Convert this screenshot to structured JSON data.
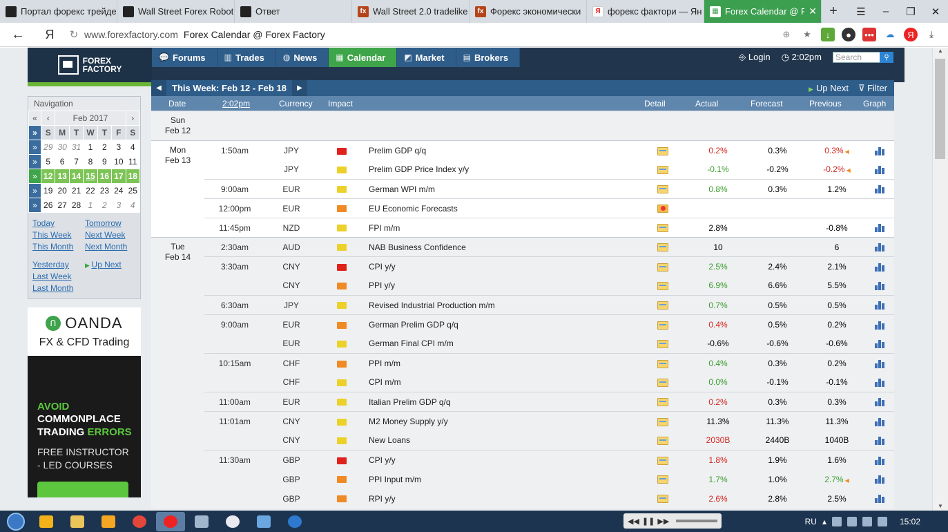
{
  "browser": {
    "tabs": [
      {
        "title": "Портал форекс трейде",
        "favicon": "dark",
        "active": false
      },
      {
        "title": "Wall Street Forex Robot",
        "favicon": "dark",
        "active": false
      },
      {
        "title": "Ответ",
        "favicon": "dark",
        "active": false
      },
      {
        "title": "Wall Street 2.0 tradelike",
        "favicon": "ff",
        "active": false
      },
      {
        "title": "Форекс экономически",
        "favicon": "ff",
        "active": false
      },
      {
        "title": "форекс фактори — Ян",
        "favicon": "yandex",
        "active": false
      },
      {
        "title": "Forex Calendar @ Fo",
        "favicon": "ff-green",
        "active": true
      }
    ],
    "new_tab": "+",
    "yandex_logo": "Я",
    "url_host": "www.forexfactory.com",
    "url_title": "Forex Calendar @ Forex Factory"
  },
  "site": {
    "logo_line1": "FOREX",
    "logo_line2": "FACTORY",
    "nav": [
      {
        "label": "Forums",
        "icon": "forums-icon",
        "active": false
      },
      {
        "label": "Trades",
        "icon": "trades-icon",
        "active": false
      },
      {
        "label": "News",
        "icon": "news-icon",
        "active": false
      },
      {
        "label": "Calendar",
        "icon": "calendar-icon",
        "active": true
      },
      {
        "label": "Market",
        "icon": "market-icon",
        "active": false
      },
      {
        "label": "Brokers",
        "icon": "brokers-icon",
        "active": false
      }
    ],
    "login": "Login",
    "time": "2:02pm",
    "search_placeholder": "Search"
  },
  "sidebar": {
    "title": "Navigation",
    "month": "Feb 2017",
    "weekdays": [
      "S",
      "M",
      "T",
      "W",
      "T",
      "F",
      "S"
    ],
    "weeks": [
      [
        "29",
        "30",
        "31",
        "1",
        "2",
        "3",
        "4"
      ],
      [
        "5",
        "6",
        "7",
        "8",
        "9",
        "10",
        "11"
      ],
      [
        "12",
        "13",
        "14",
        "15",
        "16",
        "17",
        "18"
      ],
      [
        "19",
        "20",
        "21",
        "22",
        "23",
        "24",
        "25"
      ],
      [
        "26",
        "27",
        "28",
        "1",
        "2",
        "3",
        "4"
      ]
    ],
    "links": {
      "today": "Today",
      "tomorrow": "Tomorrow",
      "this_week": "This Week",
      "next_week": "Next Week",
      "this_month": "This Month",
      "next_month": "Next Month",
      "yesterday": "Yesterday",
      "up_next": "Up Next",
      "last_week": "Last Week",
      "last_month": "Last Month"
    },
    "ad": {
      "brand": "OANDA",
      "sub": "FX & CFD Trading",
      "line1": "AVOID",
      "line2": "COMMONPLACE",
      "line3a": "TRADING ",
      "line3b": "ERRORS",
      "line4a": "FREE INSTRUCTOR",
      "line4b": "- LED COURSES"
    }
  },
  "calendar": {
    "week_label": "This Week: Feb 12 - Feb 18",
    "up_next": "Up Next",
    "filter": "Filter",
    "columns": {
      "date": "Date",
      "time": "2:02pm",
      "currency": "Currency",
      "impact": "Impact",
      "detail": "Detail",
      "actual": "Actual",
      "forecast": "Forecast",
      "previous": "Previous",
      "graph": "Graph"
    },
    "days": [
      {
        "weekday": "Sun",
        "date": "Feb 12",
        "events": []
      },
      {
        "weekday": "Mon",
        "date": "Feb 13",
        "events": [
          {
            "time": "1:50am",
            "currency": "JPY",
            "impact": "high",
            "event": "Prelim GDP q/q",
            "detail": "folder",
            "actual": "0.2%",
            "actual_color": "neg",
            "forecast": "0.3%",
            "previous": "0.3%",
            "previous_color": "neg",
            "revised": true,
            "graph": true
          },
          {
            "time": "",
            "currency": "JPY",
            "impact": "low",
            "event": "Prelim GDP Price Index y/y",
            "detail": "folder",
            "actual": "-0.1%",
            "actual_color": "pos",
            "forecast": "-0.2%",
            "previous": "-0.2%",
            "previous_color": "neg",
            "revised": true,
            "graph": true
          },
          {
            "time": "9:00am",
            "currency": "EUR",
            "impact": "low",
            "event": "German WPI m/m",
            "detail": "folder",
            "actual": "0.8%",
            "actual_color": "pos",
            "forecast": "0.3%",
            "previous": "1.2%",
            "previous_color": "",
            "revised": false,
            "graph": true
          },
          {
            "time": "12:00pm",
            "currency": "EUR",
            "impact": "medium",
            "event": "EU Economic Forecasts",
            "detail": "star",
            "actual": "",
            "actual_color": "",
            "forecast": "",
            "previous": "",
            "previous_color": "",
            "revised": false,
            "graph": false
          },
          {
            "time": "11:45pm",
            "currency": "NZD",
            "impact": "low",
            "event": "FPI m/m",
            "detail": "folder",
            "actual": "2.8%",
            "actual_color": "",
            "forecast": "",
            "previous": "-0.8%",
            "previous_color": "",
            "revised": false,
            "graph": true
          }
        ]
      },
      {
        "weekday": "Tue",
        "date": "Feb 14",
        "events": [
          {
            "time": "2:30am",
            "currency": "AUD",
            "impact": "low",
            "event": "NAB Business Confidence",
            "detail": "folder",
            "actual": "10",
            "actual_color": "",
            "forecast": "",
            "previous": "6",
            "previous_color": "",
            "revised": false,
            "graph": true
          },
          {
            "time": "3:30am",
            "currency": "CNY",
            "impact": "high",
            "event": "CPI y/y",
            "detail": "folder",
            "actual": "2.5%",
            "actual_color": "pos",
            "forecast": "2.4%",
            "previous": "2.1%",
            "previous_color": "",
            "revised": false,
            "graph": true
          },
          {
            "time": "",
            "currency": "CNY",
            "impact": "medium",
            "event": "PPI y/y",
            "detail": "folder",
            "actual": "6.9%",
            "actual_color": "pos",
            "forecast": "6.6%",
            "previous": "5.5%",
            "previous_color": "",
            "revised": false,
            "graph": true
          },
          {
            "time": "6:30am",
            "currency": "JPY",
            "impact": "low",
            "event": "Revised Industrial Production m/m",
            "detail": "folder",
            "actual": "0.7%",
            "actual_color": "pos",
            "forecast": "0.5%",
            "previous": "0.5%",
            "previous_color": "",
            "revised": false,
            "graph": true
          },
          {
            "time": "9:00am",
            "currency": "EUR",
            "impact": "medium",
            "event": "German Prelim GDP q/q",
            "detail": "folder",
            "actual": "0.4%",
            "actual_color": "neg",
            "forecast": "0.5%",
            "previous": "0.2%",
            "previous_color": "",
            "revised": false,
            "graph": true
          },
          {
            "time": "",
            "currency": "EUR",
            "impact": "low",
            "event": "German Final CPI m/m",
            "detail": "folder",
            "actual": "-0.6%",
            "actual_color": "",
            "forecast": "-0.6%",
            "previous": "-0.6%",
            "previous_color": "",
            "revised": false,
            "graph": true
          },
          {
            "time": "10:15am",
            "currency": "CHF",
            "impact": "medium",
            "event": "PPI m/m",
            "detail": "folder",
            "actual": "0.4%",
            "actual_color": "pos",
            "forecast": "0.3%",
            "previous": "0.2%",
            "previous_color": "",
            "revised": false,
            "graph": true
          },
          {
            "time": "",
            "currency": "CHF",
            "impact": "low",
            "event": "CPI m/m",
            "detail": "folder",
            "actual": "0.0%",
            "actual_color": "pos",
            "forecast": "-0.1%",
            "previous": "-0.1%",
            "previous_color": "",
            "revised": false,
            "graph": true
          },
          {
            "time": "11:00am",
            "currency": "EUR",
            "impact": "low",
            "event": "Italian Prelim GDP q/q",
            "detail": "folder",
            "actual": "0.2%",
            "actual_color": "neg",
            "forecast": "0.3%",
            "previous": "0.3%",
            "previous_color": "",
            "revised": false,
            "graph": true
          },
          {
            "time": "11:01am",
            "currency": "CNY",
            "impact": "low",
            "event": "M2 Money Supply y/y",
            "detail": "folder",
            "actual": "11.3%",
            "actual_color": "",
            "forecast": "11.3%",
            "previous": "11.3%",
            "previous_color": "",
            "revised": false,
            "graph": true
          },
          {
            "time": "",
            "currency": "CNY",
            "impact": "low",
            "event": "New Loans",
            "detail": "folder",
            "actual": "2030B",
            "actual_color": "neg",
            "forecast": "2440B",
            "previous": "1040B",
            "previous_color": "",
            "revised": false,
            "graph": true
          },
          {
            "time": "11:30am",
            "currency": "GBP",
            "impact": "high",
            "event": "CPI y/y",
            "detail": "folder",
            "actual": "1.8%",
            "actual_color": "neg",
            "forecast": "1.9%",
            "previous": "1.6%",
            "previous_color": "",
            "revised": false,
            "graph": true
          },
          {
            "time": "",
            "currency": "GBP",
            "impact": "medium",
            "event": "PPI Input m/m",
            "detail": "folder",
            "actual": "1.7%",
            "actual_color": "pos",
            "forecast": "1.0%",
            "previous": "2.7%",
            "previous_color": "pos",
            "revised": true,
            "graph": true
          },
          {
            "time": "",
            "currency": "GBP",
            "impact": "medium",
            "event": "RPI y/y",
            "detail": "folder",
            "actual": "2.6%",
            "actual_color": "neg",
            "forecast": "2.8%",
            "previous": "2.5%",
            "previous_color": "",
            "revised": false,
            "graph": true
          }
        ]
      }
    ]
  },
  "taskbar": {
    "lang": "RU",
    "clock": "15:02",
    "apps": [
      "explorer",
      "folder",
      "media",
      "chrome",
      "yandex",
      "calculator",
      "itunes",
      "notes",
      "teamviewer"
    ],
    "active_app": "yandex"
  }
}
